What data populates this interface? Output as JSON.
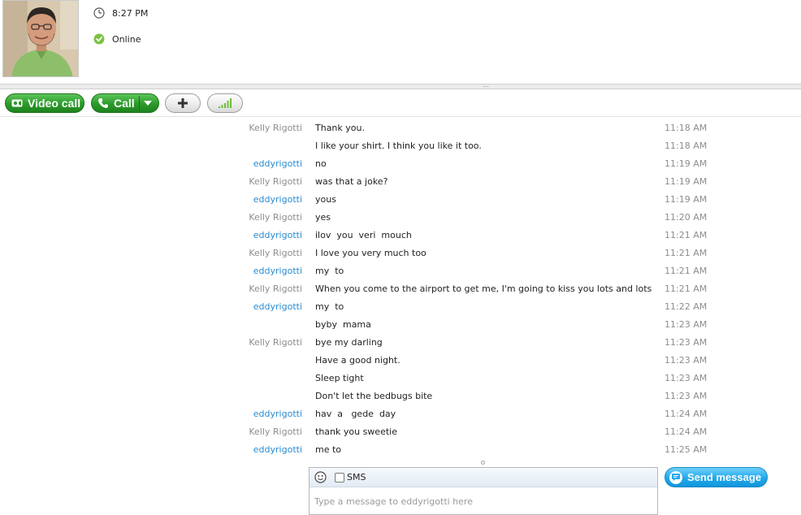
{
  "profile": {
    "local_time": "8:27 PM",
    "status": "Online"
  },
  "toolbar": {
    "video_call_label": "Video call",
    "call_label": "Call"
  },
  "messages": [
    {
      "sender": "Kelly Rigotti",
      "self": false,
      "text": "Thank you.",
      "time": "11:18 AM"
    },
    {
      "sender": "",
      "self": false,
      "text": "I like your shirt. I think you like it too.",
      "time": "11:18 AM"
    },
    {
      "sender": "eddyrigotti",
      "self": true,
      "text": "no",
      "time": "11:19 AM"
    },
    {
      "sender": "Kelly Rigotti",
      "self": false,
      "text": "was that a joke?",
      "time": "11:19 AM"
    },
    {
      "sender": "eddyrigotti",
      "self": true,
      "text": "yous",
      "time": "11:19 AM"
    },
    {
      "sender": "Kelly Rigotti",
      "self": false,
      "text": "yes",
      "time": "11:20 AM"
    },
    {
      "sender": "eddyrigotti",
      "self": true,
      "text": "ilov  you  veri  mouch",
      "time": "11:21 AM"
    },
    {
      "sender": "Kelly Rigotti",
      "self": false,
      "text": "I love you very much too",
      "time": "11:21 AM"
    },
    {
      "sender": "eddyrigotti",
      "self": true,
      "text": "my  to",
      "time": "11:21 AM"
    },
    {
      "sender": "Kelly Rigotti",
      "self": false,
      "text": "When you come to the airport to get me, I'm going to kiss you lots and lots",
      "time": "11:21 AM"
    },
    {
      "sender": "eddyrigotti",
      "self": true,
      "text": "my  to",
      "time": "11:22 AM"
    },
    {
      "sender": "",
      "self": true,
      "text": "byby  mama",
      "time": "11:23 AM"
    },
    {
      "sender": "Kelly Rigotti",
      "self": false,
      "text": "bye my darling",
      "time": "11:23 AM"
    },
    {
      "sender": "",
      "self": false,
      "text": "Have a good night.",
      "time": "11:23 AM"
    },
    {
      "sender": "",
      "self": false,
      "text": "Sleep tight",
      "time": "11:23 AM"
    },
    {
      "sender": "",
      "self": false,
      "text": "Don't let the bedbugs bite",
      "time": "11:23 AM"
    },
    {
      "sender": "eddyrigotti",
      "self": true,
      "text": "hav  a   gede  day",
      "time": "11:24 AM"
    },
    {
      "sender": "Kelly Rigotti",
      "self": false,
      "text": "thank you sweetie",
      "time": "11:24 AM"
    },
    {
      "sender": "eddyrigotti",
      "self": true,
      "text": "me to",
      "time": "11:25 AM"
    }
  ],
  "composer": {
    "sms_label": "SMS",
    "placeholder": "Type a message to eddyrigotti here",
    "send_label": "Send message"
  },
  "colors": {
    "accent_green": "#2b9a2a",
    "self_sender": "#2a8bd1",
    "other_sender": "#8d8d8d",
    "send_blue": "#22a8ea"
  }
}
